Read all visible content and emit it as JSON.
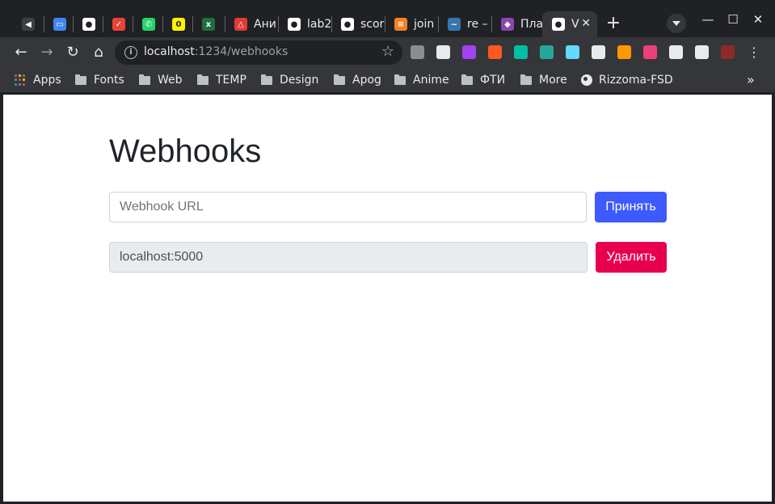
{
  "browser": {
    "tabs": [
      {
        "title": "",
        "fav_color": "#3c4043",
        "fav_glyph": "◀"
      },
      {
        "title": "",
        "fav_color": "#4285f4",
        "fav_glyph": "▭"
      },
      {
        "title": "",
        "fav_color": "#ffffff",
        "fav_glyph": "●"
      },
      {
        "title": "",
        "fav_color": "#ea4335",
        "fav_glyph": "✓"
      },
      {
        "title": "",
        "fav_color": "#25d366",
        "fav_glyph": "✆"
      },
      {
        "title": "",
        "fav_color": "#fff200",
        "fav_glyph": "0"
      },
      {
        "title": "",
        "fav_color": "#1d6f42",
        "fav_glyph": "x"
      },
      {
        "title": "Ани",
        "fav_color": "#e53935",
        "fav_glyph": "△"
      },
      {
        "title": "lab2",
        "fav_color": "#ffffff",
        "fav_glyph": "●"
      },
      {
        "title": "scor",
        "fav_color": "#ffffff",
        "fav_glyph": "●"
      },
      {
        "title": "join",
        "fav_color": "#f48024",
        "fav_glyph": "≡"
      },
      {
        "title": "re –",
        "fav_color": "#3776ab",
        "fav_glyph": "~"
      },
      {
        "title": "Пла",
        "fav_color": "#8e44ad",
        "fav_glyph": "◆"
      },
      {
        "title": "V",
        "fav_color": "#ffffff",
        "fav_glyph": "●",
        "active": true
      }
    ],
    "active_tab_close": "✕",
    "new_tab": "+",
    "window_controls": {
      "minimize": "—",
      "maximize": "☐",
      "close": "✕"
    },
    "nav": {
      "back": "←",
      "forward": "→",
      "reload": "↻",
      "home": "⌂"
    },
    "address": {
      "host": "localhost",
      "path": ":1234/webhooks",
      "info_icon": "i",
      "bookmark_star": "☆"
    },
    "extensions": [
      "#8a8d91",
      "#e8eaed",
      "#a142f4",
      "#ff5722",
      "#00bfa5",
      "#26a69a",
      "#61dafb",
      "#e8eaed",
      "#ff9800",
      "#ec407a",
      "#e8eaed",
      "#e8eaed",
      "#8d2b2b"
    ],
    "bookmarks": [
      {
        "label": "Apps",
        "type": "apps"
      },
      {
        "label": "Fonts",
        "type": "folder"
      },
      {
        "label": "Web",
        "type": "folder"
      },
      {
        "label": "TEMP",
        "type": "folder"
      },
      {
        "label": "Design",
        "type": "folder"
      },
      {
        "label": "Apog",
        "type": "folder"
      },
      {
        "label": "Anime",
        "type": "folder"
      },
      {
        "label": "ФТИ",
        "type": "folder"
      },
      {
        "label": "More",
        "type": "folder"
      },
      {
        "label": "Rizzoma-FSD",
        "type": "globe"
      }
    ],
    "bookmarks_overflow": "»"
  },
  "page": {
    "title": "Webhooks",
    "new_webhook": {
      "placeholder": "Webhook URL",
      "value": "",
      "submit_label": "Принять",
      "submit_color": "#3d5afe"
    },
    "webhooks": [
      {
        "url": "localhost:5000",
        "delete_label": "Удалить",
        "delete_color": "#e8004f"
      }
    ]
  }
}
